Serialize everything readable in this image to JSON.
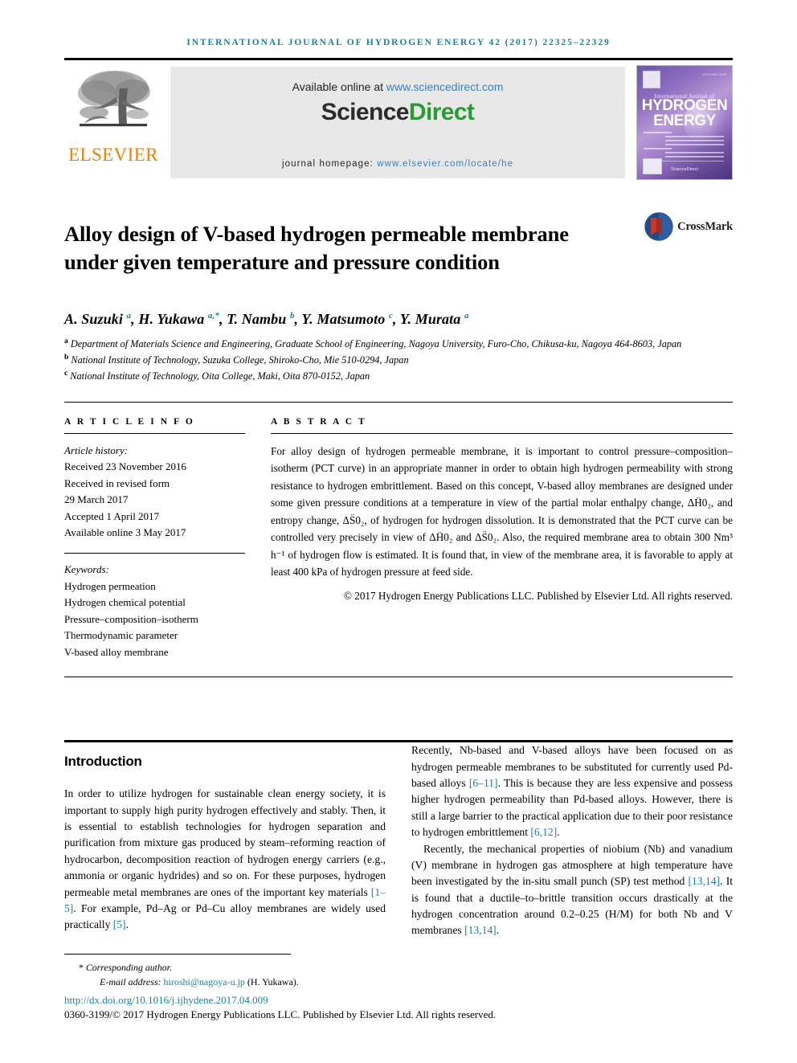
{
  "running_head": "INTERNATIONAL JOURNAL OF HYDROGEN ENERGY 42 (2017) 22325–22329",
  "masthead": {
    "publisher_name": "ELSEVIER",
    "available_prefix": "Available online at ",
    "available_url": "www.sciencedirect.com",
    "sciencedirect_science": "Science",
    "sciencedirect_direct": "Direct",
    "homepage_label": "journal homepage: ",
    "homepage_url": "www.elsevier.com/locate/he",
    "cover": {
      "small_title": "International Journal of",
      "big_title_line1": "HYDROGEN",
      "big_title_line2": "ENERGY",
      "issn_corner": "ISSN 0360-3199",
      "footer_mark": "ScienceDirect"
    },
    "colors": {
      "elsevier_orange": "#f08000",
      "sciencedirect_green": "#2a9a34",
      "link_blue": "#1a7fa8"
    }
  },
  "crossmark": {
    "label": "CrossMark"
  },
  "article": {
    "title": "Alloy design of V-based hydrogen permeable membrane under given temperature and pressure condition",
    "authors_html": "A. Suzuki <sup>a</sup>, H. Yukawa <sup>a,*</sup>, T. Nambu <sup>b</sup>, Y. Matsumoto <sup>c</sup>, Y. Murata <sup>a</sup>",
    "affiliations": [
      "a Department of Materials Science and Engineering, Graduate School of Engineering, Nagoya University, Furo-Cho, Chikusa-ku, Nagoya 464-8603, Japan",
      "b National Institute of Technology, Suzuka College, Shiroko-Cho, Mie 510-0294, Japan",
      "c National Institute of Technology, Oita College, Maki, Oita 870-0152, Japan"
    ]
  },
  "article_info": {
    "heading": "A R T I C L E   I N F O",
    "history_label": "Article history:",
    "history": [
      "Received 23 November 2016",
      "Received in revised form",
      "29 March 2017",
      "Accepted 1 April 2017",
      "Available online 3 May 2017"
    ],
    "keywords_label": "Keywords:",
    "keywords": [
      "Hydrogen permeation",
      "Hydrogen chemical potential",
      "Pressure–composition–isotherm",
      "Thermodynamic parameter",
      "V-based alloy membrane"
    ]
  },
  "abstract": {
    "heading": "A B S T R A C T",
    "paragraph_html": "For alloy design of hydrogen permeable membrane, it is important to control pressure–composition–isotherm (PCT curve) in an appropriate manner in order to obtain high hydrogen permeability with strong resistance to hydrogen embrittlement. Based on this concept, V-based alloy membranes are designed under some given pressure conditions at a temperature in view of the partial molar enthalpy change, ΔḦ0₂, and entropy change, ΔS̈0₂, of hydrogen for hydrogen dissolution. It is demonstrated that the PCT curve can be controlled very precisely in view of ΔḦ0₂ and ΔS̈0₂. Also, the required membrane area to obtain 300 Nm³ h⁻¹ of hydrogen flow is estimated. It is found that, in view of the membrane area, it is favorable to apply at least 400 kPa of hydrogen pressure at feed side.",
    "copyright": "© 2017 Hydrogen Energy Publications LLC. Published by Elsevier Ltd. All rights reserved."
  },
  "body": {
    "section_title": "Introduction",
    "left_paragraph_html": "In order to utilize hydrogen for sustainable clean energy society, it is important to supply high purity hydrogen effectively and stably. Then, it is essential to establish technologies for hydrogen separation and purification from mixture gas produced by steam–reforming reaction of hydrocarbon, decomposition reaction of hydrogen energy carriers (e.g., ammonia or organic hydrides) and so on. For these purposes, hydrogen permeable metal membranes are ones of the important key materials <span class=\"ref\">[1–5]</span>. For example, Pd–Ag or Pd–Cu alloy membranes are widely used practically <span class=\"ref\">[5]</span>.",
    "right_paragraph1_html": "Recently, Nb-based and V-based alloys have been focused on as hydrogen permeable membranes to be substituted for currently used Pd-based alloys <span class=\"ref\">[6–11]</span>. This is because they are less expensive and possess higher hydrogen permeability than Pd-based alloys. However, there is still a large barrier to the practical application due to their poor resistance to hydrogen embrittlement <span class=\"ref\">[6,12]</span>.",
    "right_paragraph2_html": "Recently, the mechanical properties of niobium (Nb) and vanadium (V) membrane in hydrogen gas atmosphere at high temperature have been investigated by the in-situ small punch (SP) test method <span class=\"ref\">[13,14]</span>. It is found that a ductile–to–brittle transition occurs drastically at the hydrogen concentration around 0.2–0.25 (H/M) for both Nb and V membranes <span class=\"ref\">[13,14]</span>."
  },
  "footer": {
    "corresponding_star": "*",
    "corresponding_text": "Corresponding author.",
    "email_label": "E-mail address: ",
    "email_address": "hiroshi@nagoya-u.jp",
    "email_owner": " (H. Yukawa).",
    "doi": "http://dx.doi.org/10.1016/j.ijhydene.2017.04.009",
    "issn_line": "0360-3199/© 2017 Hydrogen Energy Publications LLC. Published by Elsevier Ltd. All rights reserved."
  }
}
